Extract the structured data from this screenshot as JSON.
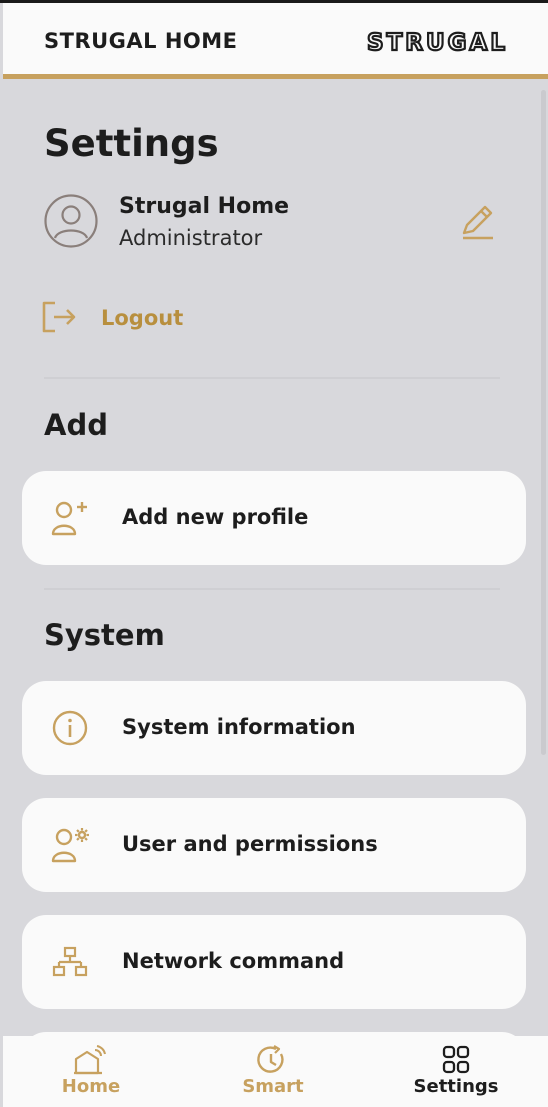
{
  "header": {
    "title": "STRUGAL HOME",
    "logo_text": "STRUGAL"
  },
  "settings": {
    "title": "Settings"
  },
  "user": {
    "name": "Strugal Home",
    "role": "Administrator"
  },
  "logout": {
    "label": "Logout"
  },
  "sections": {
    "add": {
      "title": "Add",
      "items": [
        {
          "label": "Add new profile",
          "icon": "add-user-icon"
        }
      ]
    },
    "system": {
      "title": "System",
      "items": [
        {
          "label": "System information",
          "icon": "info-icon"
        },
        {
          "label": "User and permissions",
          "icon": "user-gear-icon"
        },
        {
          "label": "Network command",
          "icon": "network-icon"
        }
      ]
    }
  },
  "nav": {
    "items": [
      {
        "label": "Home",
        "icon": "home-icon",
        "active": false
      },
      {
        "label": "Smart",
        "icon": "smart-clock-icon",
        "active": false
      },
      {
        "label": "Settings",
        "icon": "grid-icon",
        "active": true
      }
    ]
  },
  "colors": {
    "accent": "#c7a15f",
    "accent_text": "#b88f3e",
    "background": "#d8d8dc",
    "card": "#fafafa",
    "text": "#1d1d1d"
  }
}
